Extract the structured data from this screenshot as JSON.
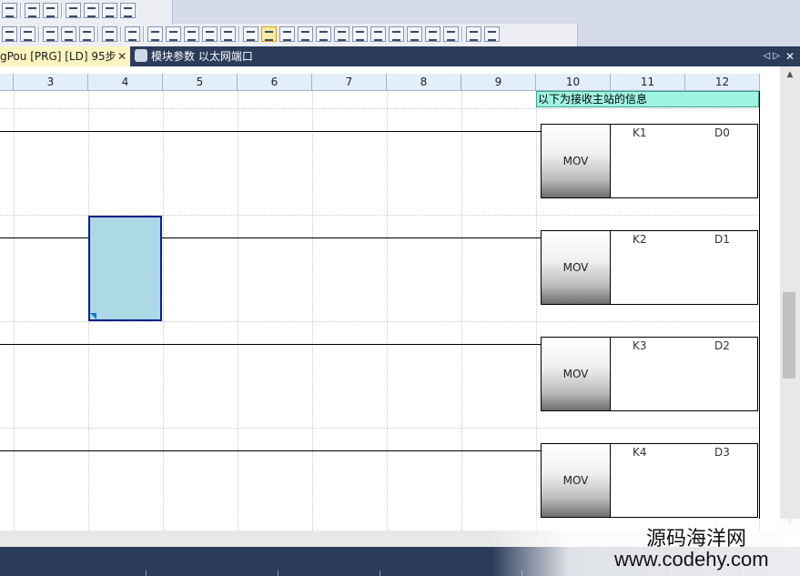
{
  "tabs": {
    "active_label": "gPou [PRG] [LD] 95步",
    "active_close": "✕",
    "second_label": "模块参数 以太网端口",
    "nav_arrows": "◁ ▷",
    "nav_close": "✕"
  },
  "columns": [
    "3",
    "4",
    "5",
    "6",
    "7",
    "8",
    "9",
    "10",
    "11",
    "12"
  ],
  "comment": "以下为接收主站的信息",
  "instructions": [
    {
      "op": "MOV",
      "src": "K1",
      "dst": "D0"
    },
    {
      "op": "MOV",
      "src": "K2",
      "dst": "D1"
    },
    {
      "op": "MOV",
      "src": "K3",
      "dst": "D2"
    },
    {
      "op": "MOV",
      "src": "K4",
      "dst": "D3"
    }
  ],
  "scroll": {
    "up": "▲",
    "down": "▼"
  },
  "watermark": {
    "title": "源码海洋网",
    "url": "www.codehy.com"
  }
}
